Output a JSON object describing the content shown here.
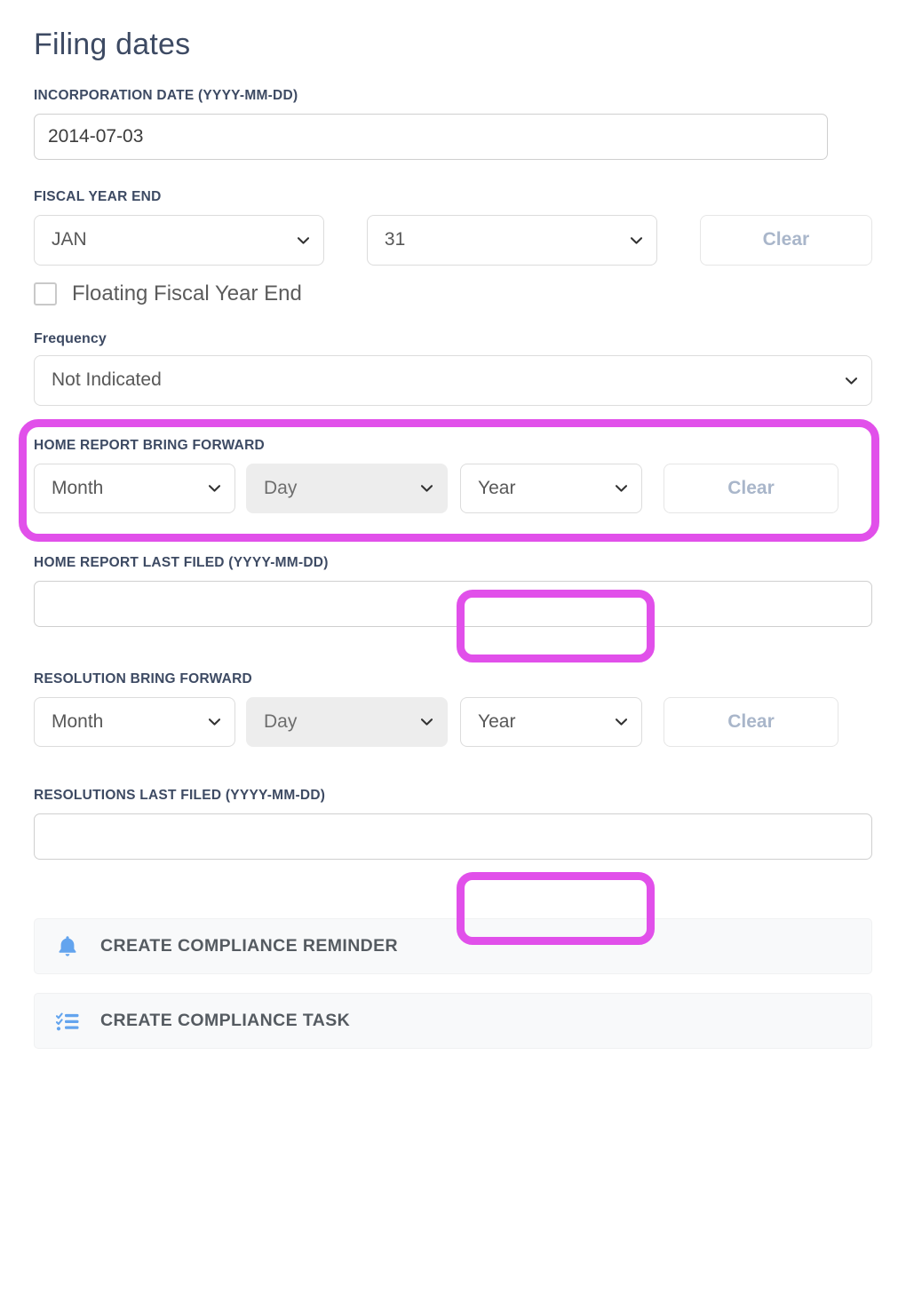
{
  "page": {
    "title": "Filing dates"
  },
  "colors": {
    "heading": "#3d4a63",
    "label": "#3d4a63",
    "highlight": "#e150ea",
    "icon_blue": "#63a4ee",
    "clear_text": "#a9b6ca",
    "disabled_bg": "#ededed"
  },
  "incorporation_date": {
    "label": "INCORPORATION DATE (YYYY-MM-DD)",
    "value": "2014-07-03",
    "placeholder": ""
  },
  "fiscal_year_end": {
    "label": "FISCAL YEAR END",
    "month": "JAN",
    "day": "31",
    "clear_label": "Clear",
    "floating_checkbox_label": "Floating Fiscal Year End",
    "floating_checked": false
  },
  "frequency": {
    "label": "Frequency",
    "value": "Not Indicated",
    "highlighted": true
  },
  "home_report_bring_forward": {
    "label": "HOME REPORT BRING FORWARD",
    "month": "Month",
    "day": "Day",
    "year": "Year",
    "day_disabled": true,
    "year_highlighted": true,
    "clear_label": "Clear"
  },
  "home_report_last_filed": {
    "label": "HOME REPORT LAST FILED (YYYY-MM-DD)",
    "value": "",
    "placeholder": ""
  },
  "resolution_bring_forward": {
    "label": "RESOLUTION BRING FORWARD",
    "month": "Month",
    "day": "Day",
    "year": "Year",
    "day_disabled": true,
    "year_highlighted": true,
    "clear_label": "Clear"
  },
  "resolutions_last_filed": {
    "label": "RESOLUTIONS LAST FILED (YYYY-MM-DD)",
    "value": "",
    "placeholder": ""
  },
  "actions": {
    "reminder": {
      "label": "CREATE COMPLIANCE REMINDER",
      "icon": "bell-icon"
    },
    "task": {
      "label": "CREATE COMPLIANCE TASK",
      "icon": "checklist-icon"
    }
  }
}
